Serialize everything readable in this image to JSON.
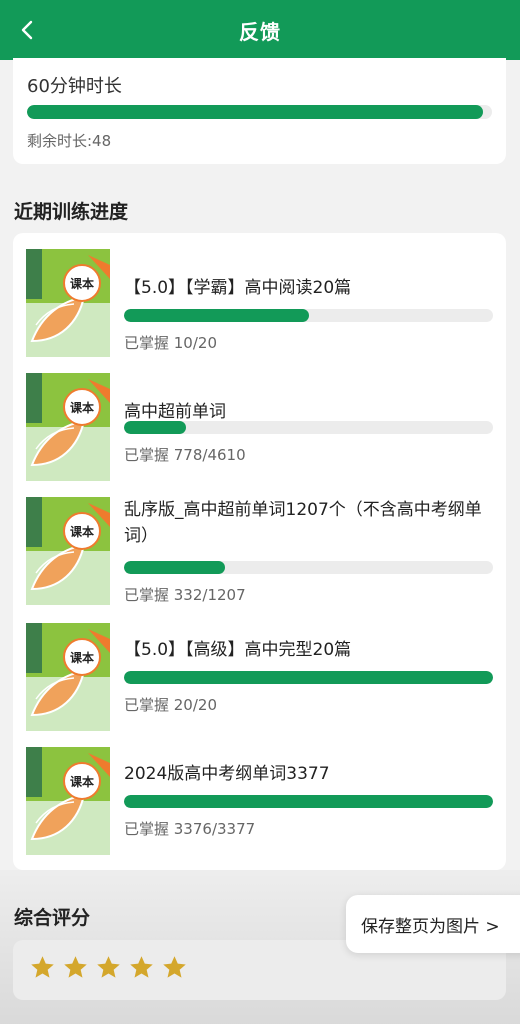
{
  "header": {
    "title": "反馈",
    "back_icon": "chevron-left-icon"
  },
  "time": {
    "label": "60分钟时长",
    "progress": 0.98,
    "remaining": "剩余时长:48"
  },
  "recent": {
    "title": "近期训练进度",
    "cover_label": "课本",
    "items": [
      {
        "title": "【5.0】【学霸】高中阅读20篇",
        "mastered": "已掌握 10/20",
        "progress": 0.5
      },
      {
        "title": "高中超前单词",
        "mastered": "已掌握 778/4610",
        "progress": 0.169
      },
      {
        "title": "乱序版_高中超前单词1207个（不含高中考纲单词）",
        "mastered": "已掌握 332/1207",
        "progress": 0.275
      },
      {
        "title": "【5.0】【高级】高中完型20篇",
        "mastered": "已掌握 20/20",
        "progress": 1.0
      },
      {
        "title": "2024版高中考纲单词3377",
        "mastered": "已掌握 3376/3377",
        "progress": 1.0
      }
    ]
  },
  "score": {
    "title": "综合评分",
    "stars": 5,
    "star_color": "#d4a72c"
  },
  "save": {
    "label": "保存整页为图片 >"
  },
  "colors": {
    "accent": "#129a58",
    "track": "#ececec"
  }
}
